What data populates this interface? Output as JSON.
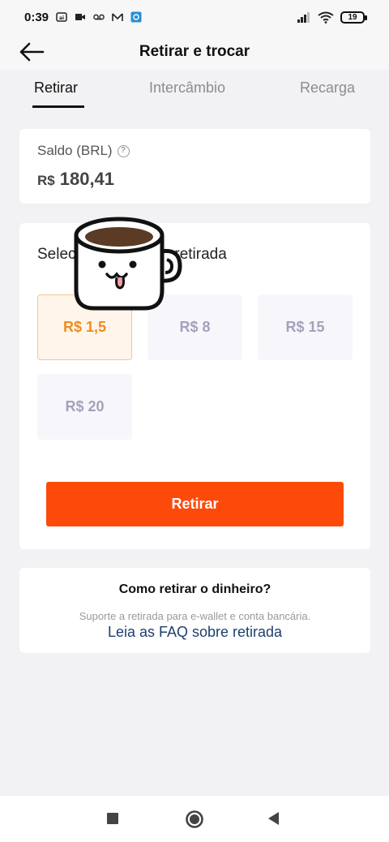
{
  "status_bar": {
    "time": "0:39",
    "battery": "19"
  },
  "header": {
    "title": "Retirar e trocar"
  },
  "tabs": [
    {
      "label": "Retirar"
    },
    {
      "label": "Intercâmbio"
    },
    {
      "label": "Recarga"
    }
  ],
  "balance": {
    "label": "Saldo (BRL)",
    "currency": "R$",
    "amount": "180,41"
  },
  "withdraw": {
    "title_start": "Selec",
    "title_end": "a retirada",
    "options": [
      {
        "label": "R$ 1,5",
        "selected": true
      },
      {
        "label": "R$ 8",
        "selected": false
      },
      {
        "label": "R$ 15",
        "selected": false
      },
      {
        "label": "R$ 20",
        "selected": false
      }
    ],
    "button_label": "Retirar"
  },
  "info": {
    "title": "Como retirar o dinheiro?",
    "subtitle": "Suporte a retirada para e-wallet e conta bancária.",
    "link": "Leia as FAQ sobre retirada"
  },
  "colors": {
    "accent": "#fd4a0b",
    "selected_text": "#f08c1f",
    "link": "#1d3f6e"
  }
}
